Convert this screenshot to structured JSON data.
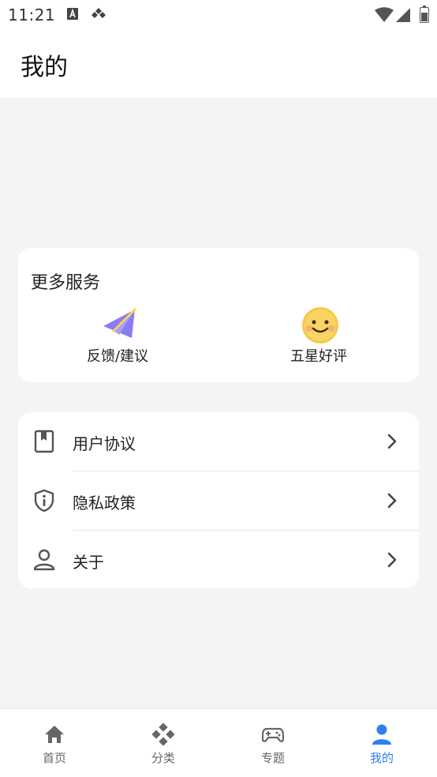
{
  "status_bar": {
    "time": "11:21"
  },
  "header": {
    "title": "我的"
  },
  "services": {
    "title": "更多服务",
    "items": [
      {
        "label": "反馈/建议",
        "icon": "paper-plane-icon"
      },
      {
        "label": "五星好评",
        "icon": "smiley-icon"
      }
    ]
  },
  "menu": {
    "items": [
      {
        "label": "用户协议",
        "icon": "bookmark-book-icon"
      },
      {
        "label": "隐私政策",
        "icon": "shield-info-icon"
      },
      {
        "label": "关于",
        "icon": "person-icon"
      }
    ]
  },
  "tabbar": {
    "items": [
      {
        "label": "首页",
        "icon": "home-icon"
      },
      {
        "label": "分类",
        "icon": "category-icon"
      },
      {
        "label": "专题",
        "icon": "gamepad-icon"
      },
      {
        "label": "我的",
        "icon": "user-icon"
      }
    ],
    "active_index": 3
  },
  "colors": {
    "accent": "#2f80ed",
    "background": "#f4f4f4",
    "card": "#ffffff",
    "icon_gray": "#666666"
  }
}
